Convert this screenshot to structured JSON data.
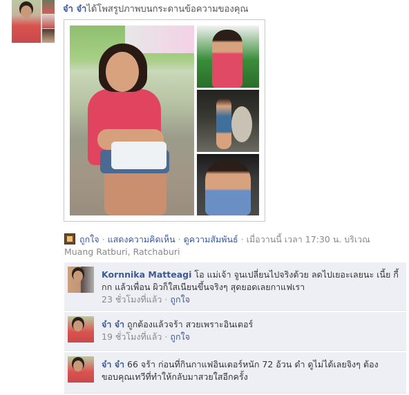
{
  "post": {
    "author": "จ๋า จ๋า",
    "action_text": "ได้โพสรูปภาพบนกระดานข้อความของคุณ"
  },
  "actions": {
    "like": "ถูกใจ",
    "comment": "แสดงความคิดเห็น",
    "see_friendship": "ดูความสัมพันธ์",
    "time_text": "เมื่อวานนี้ เวลา 17:30 น. บริเวณ",
    "location": "Muang Ratburi, Ratchaburi",
    "separator": "·"
  },
  "comments": [
    {
      "author": "Kornnika Matteagi",
      "text": "โอ แม่เจ้า จูนเปลี่ยนไปจริงด้วย ลดไปเยอะเลยนะ เนี้ย กี้กก แล้วเพื่อน ผิวก็ใสเนียนขึ้นจริงๆ สุดยอดเลยกาแฟเรา",
      "time": "23 ชั่วโมงที่แล้ว",
      "like": "ถูกใจ"
    },
    {
      "author": "จ๋า จ๋า",
      "text": "ถูกต้องแล้วจร้า สวยเพราะอินเตอร์",
      "time": "19 ชั่วโมงที่แล้ว",
      "like": "ถูกใจ"
    },
    {
      "author": "จ๋า จ๋า",
      "text": "66 จร้า ก่อนที่กินกาแฟอินเตอร์หนัก 72 อ้วน ดำ ดูไม่ได้เลยจิงๆ ต้องขอบคุณเทวีที่ทำให้กลับมาสวยใสอีกครั้ง",
      "time": "",
      "like": ""
    }
  ],
  "colors": {
    "link": "#3b5998",
    "meta": "#888888",
    "comment_bg": "#edeff4"
  }
}
